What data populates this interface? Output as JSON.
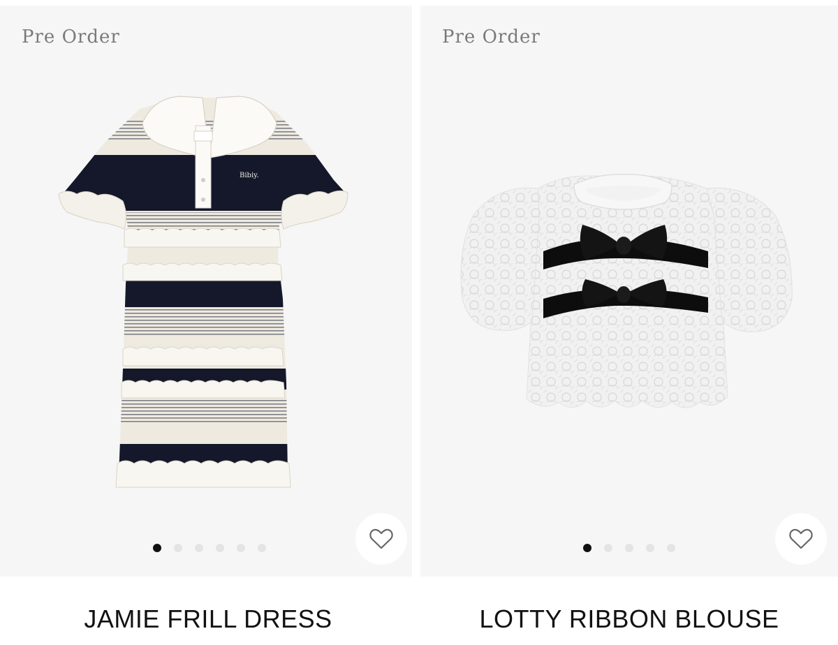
{
  "products": [
    {
      "badge": "Pre Order",
      "name": "JAMIE FRILL DRESS",
      "logo_text": "Bibiy.",
      "image_count": 6,
      "active_image": 1
    },
    {
      "badge": "Pre Order",
      "name": "LOTTY RIBBON BLOUSE",
      "image_count": 5,
      "active_image": 1
    }
  ],
  "colors": {
    "image_bg": "#f6f6f6",
    "navy": "#14182a",
    "cream": "#efeae0",
    "dot_active": "#111111",
    "dot_inactive": "#e4e4e4"
  },
  "icons": {
    "wishlist": "heart-icon"
  }
}
